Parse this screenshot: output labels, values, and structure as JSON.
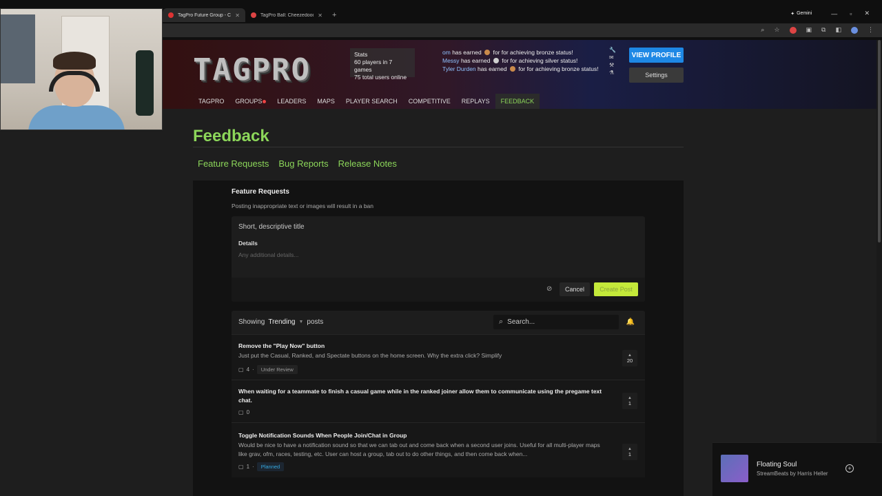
{
  "browser": {
    "tabs": [
      {
        "title": "TagPro Future Group - Comm"
      },
      {
        "title": "TagPro Ball: Cheezedoodle"
      }
    ],
    "gemini_label": "Gemini"
  },
  "site": {
    "logo_text": "TAGPRO",
    "stats": {
      "title": "Stats",
      "line1": "60 players in 7 games",
      "line2": "75 total users online"
    },
    "earned": [
      {
        "name": "om",
        "text": "has earned",
        "tail": "for for achieving bronze status!",
        "medal_color": "#c98a4b"
      },
      {
        "name": "Messy",
        "text": "has earned",
        "tail": "for for achieving silver status!",
        "medal_color": "#cfcfcf"
      },
      {
        "name": "Tyler Durden",
        "text": "has earned",
        "tail": "for for achieving bronze status!",
        "medal_color": "#c98a4b"
      }
    ],
    "view_profile": "VIEW PROFILE",
    "settings": "Settings",
    "nav": [
      "TAGPRO",
      "GROUPS",
      "LEADERS",
      "MAPS",
      "PLAYER SEARCH",
      "COMPETITIVE",
      "REPLAYS",
      "FEEDBACK"
    ]
  },
  "feedback": {
    "page_title": "Feedback",
    "subnav": [
      "Feature Requests",
      "Bug Reports",
      "Release Notes"
    ],
    "board_title": "Feature Requests",
    "warning": "Posting inappropriate text or images will result in a ban",
    "composer": {
      "title_placeholder": "Short, descriptive title",
      "details_label": "Details",
      "details_placeholder": "Any additional details...",
      "cancel": "Cancel",
      "create": "Create Post"
    },
    "list": {
      "showing": "Showing",
      "sort": "Trending",
      "posts": "posts",
      "search_placeholder": "Search..."
    },
    "posts": [
      {
        "title": "Remove the \"Play Now\" button",
        "body": "Just put the Casual, Ranked, and Spectate buttons on the home screen. Why the extra click? Simplify",
        "comments": "4",
        "status": "Under Review",
        "votes": "20"
      },
      {
        "title": "When waiting for a teammate to finish a casual game while in the ranked joiner allow them to communicate using the pregame text chat.",
        "body": "",
        "comments": "0",
        "status": "",
        "votes": "1"
      },
      {
        "title": "Toggle Notification Sounds When People Join/Chat in Group",
        "body": "Would be nice to have a notification sound so that we can tab out and come back when a second user joins. Useful for all multi-player maps like grav, ofm, races, testing, etc. User can host a group, tab out to do other things, and then come back when...",
        "comments": "1",
        "status": "Planned",
        "votes": "1"
      }
    ]
  },
  "now_playing": {
    "song": "Floating Soul",
    "artist": "StreamBeats by Harris Heller"
  }
}
